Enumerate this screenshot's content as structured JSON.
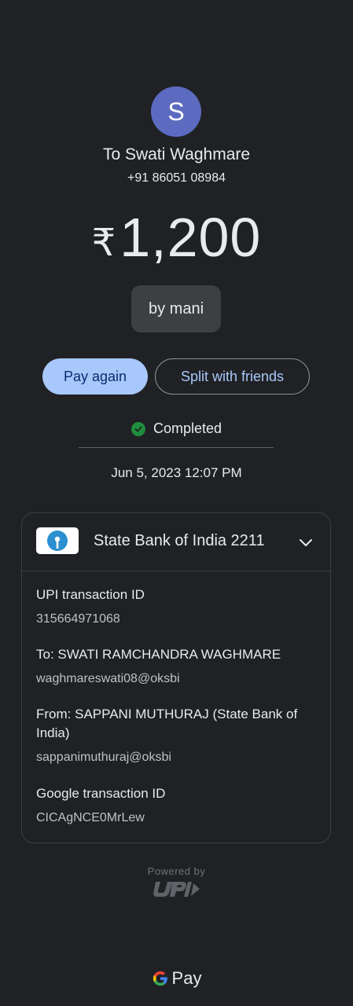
{
  "recipient": {
    "initial": "S",
    "name": "To Swati Waghmare",
    "phone": "+91 86051 08984"
  },
  "payment": {
    "currency_symbol": "₹",
    "amount": "1,200",
    "note": "by mani"
  },
  "actions": {
    "pay_again": "Pay again",
    "split": "Split with friends"
  },
  "status": {
    "text": "Completed",
    "datetime": "Jun 5, 2023 12:07 PM"
  },
  "bank": {
    "name": "State Bank of India 2211"
  },
  "details": [
    {
      "label": "UPI transaction ID",
      "value": "315664971068"
    },
    {
      "label": "To: SWATI RAMCHANDRA WAGHMARE",
      "value": "waghmareswati08@oksbi"
    },
    {
      "label": "From: SAPPANI  MUTHURAJ (State Bank of India)",
      "value": "sappanimuthuraj@oksbi"
    },
    {
      "label": "Google transaction ID",
      "value": "CICAgNCE0MrLew"
    }
  ],
  "footer": {
    "powered_by": "Powered by",
    "brand": "Pay"
  },
  "colors": {
    "background": "#202124",
    "accent": "#a8c7fa",
    "success": "#1e8e3e",
    "avatar": "#5c6bc0"
  }
}
